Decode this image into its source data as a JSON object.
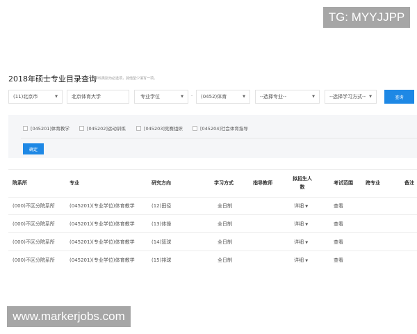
{
  "watermarks": {
    "top": "TG: MYYJJPP",
    "bottom": "www.markerjobs.com"
  },
  "header": {
    "title": "2018年硕士专业目录查询",
    "hint": "学科类别为必选项，其他至少填写一项。"
  },
  "filters": {
    "province": "(11)北京市",
    "school": "北京体育大学",
    "category": "专业学位",
    "discipline": "(0452)体育",
    "major": "--选择专业--",
    "study_mode": "--选择学习方式--",
    "search_label": "查询",
    "dash": "-"
  },
  "checkboxes": [
    "[045201]体育教学",
    "[045202]运动训练",
    "[045203]竞赛组织",
    "[045204]社会体育指导"
  ],
  "confirm_label": "确定",
  "table": {
    "headers": [
      "院系所",
      "专业",
      "研究方向",
      "学习方式",
      "指导教师",
      "拟招生人数",
      "考试范围",
      "跨专业",
      "备注"
    ],
    "rows": [
      [
        "(000)不区分院系所",
        "(045201)(专业学位)体育教学",
        "(12)田径",
        "全日制",
        "",
        "详细",
        "查看"
      ],
      [
        "(000)不区分院系所",
        "(045201)(专业学位)体育教学",
        "(13)体操",
        "全日制",
        "",
        "详细",
        "查看"
      ],
      [
        "(000)不区分院系所",
        "(045201)(专业学位)体育教学",
        "(14)篮球",
        "全日制",
        "",
        "详细",
        "查看"
      ],
      [
        "(000)不区分院系所",
        "(045201)(专业学位)体育教学",
        "(15)排球",
        "全日制",
        "",
        "详细",
        "查看"
      ]
    ]
  },
  "colors": {
    "accent": "#1e88e5",
    "panel": "#f5f6f8"
  }
}
